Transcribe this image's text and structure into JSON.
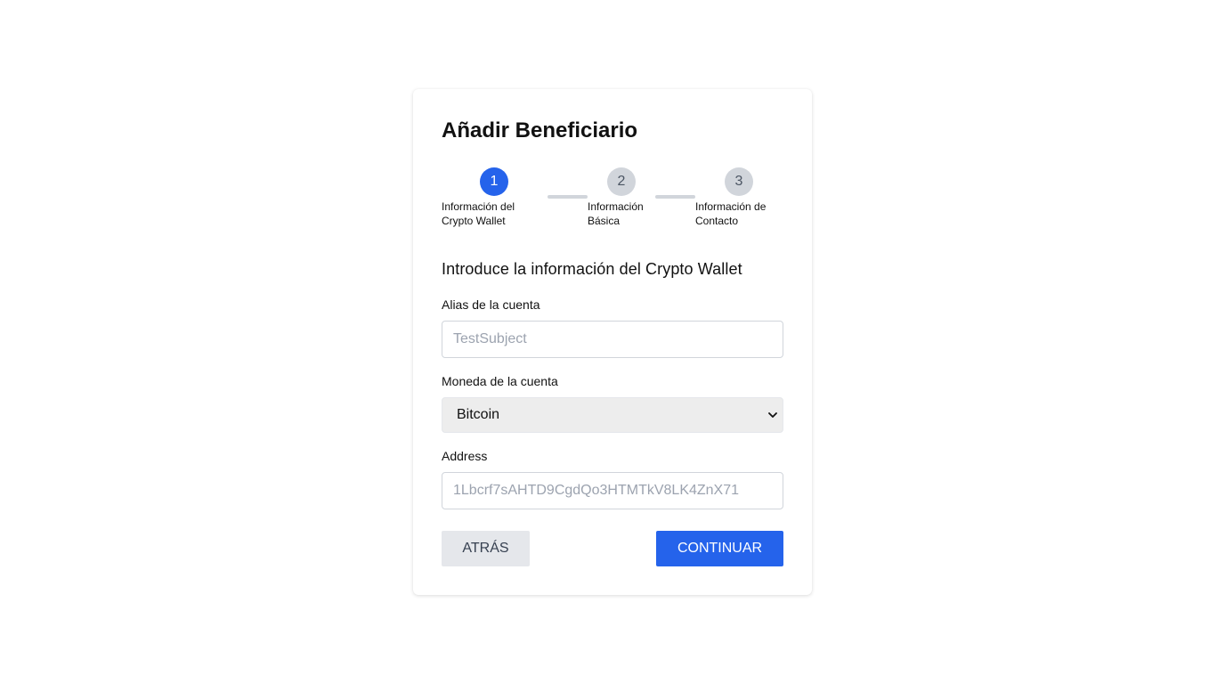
{
  "dialog": {
    "title": "Añadir Beneficiario"
  },
  "stepper": {
    "steps": [
      {
        "number": "1",
        "label": "Información del\nCrypto Wallet",
        "state": "active"
      },
      {
        "number": "2",
        "label": "Información\nBásica",
        "state": "inactive"
      },
      {
        "number": "3",
        "label": "Información de\nContacto",
        "state": "inactive"
      }
    ],
    "active_color": "#2563eb",
    "inactive_color": "#d1d5db"
  },
  "form": {
    "heading": "Introduce la información del Crypto Wallet",
    "alias": {
      "label": "Alias de la cuenta",
      "placeholder": "TestSubject",
      "value": ""
    },
    "currency": {
      "label": "Moneda de la cuenta",
      "selected": "Bitcoin",
      "icon": "chevron-down-icon"
    },
    "address": {
      "label": "Address",
      "placeholder": "1Lbcrf7sAHTD9CgdQo3HTMTkV8LK4ZnX71",
      "value": ""
    }
  },
  "actions": {
    "back_label": "ATRÁS",
    "continue_label": "CONTINUAR",
    "primary_color": "#2563eb"
  }
}
